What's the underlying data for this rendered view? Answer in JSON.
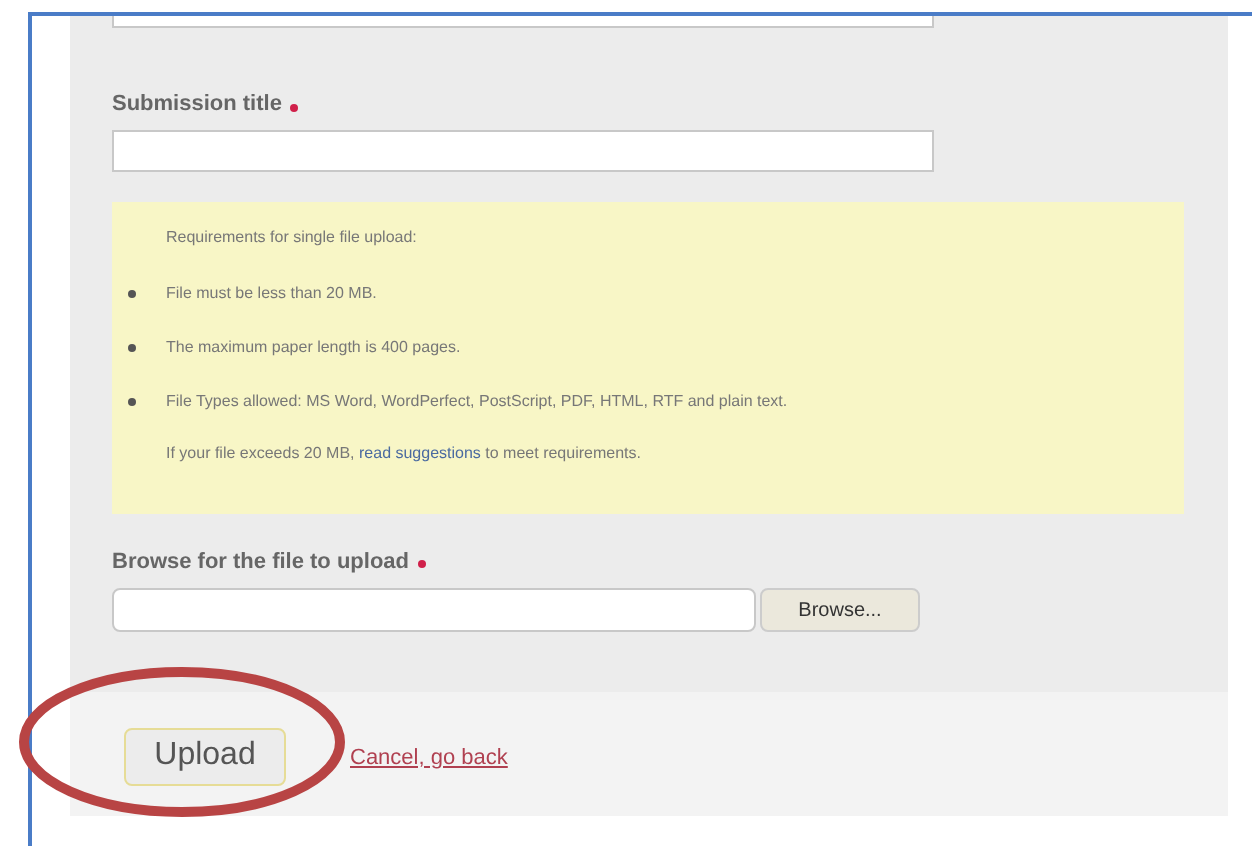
{
  "submission_title": {
    "label": "Submission title",
    "required": true
  },
  "requirements": {
    "heading": "Requirements for single file upload:",
    "items": [
      "File must be less than 20 MB.",
      "The maximum paper length is 400 pages.",
      "File Types allowed: MS Word, WordPerfect, PostScript, PDF, HTML, RTF and plain text."
    ],
    "note_before": "If your file exceeds 20 MB, ",
    "note_link": "read suggestions",
    "note_after": " to meet requirements."
  },
  "file_upload": {
    "label": "Browse for the file to upload",
    "required": true,
    "browse_button": "Browse..."
  },
  "actions": {
    "upload_button": "Upload",
    "cancel_link": "Cancel, go back"
  }
}
